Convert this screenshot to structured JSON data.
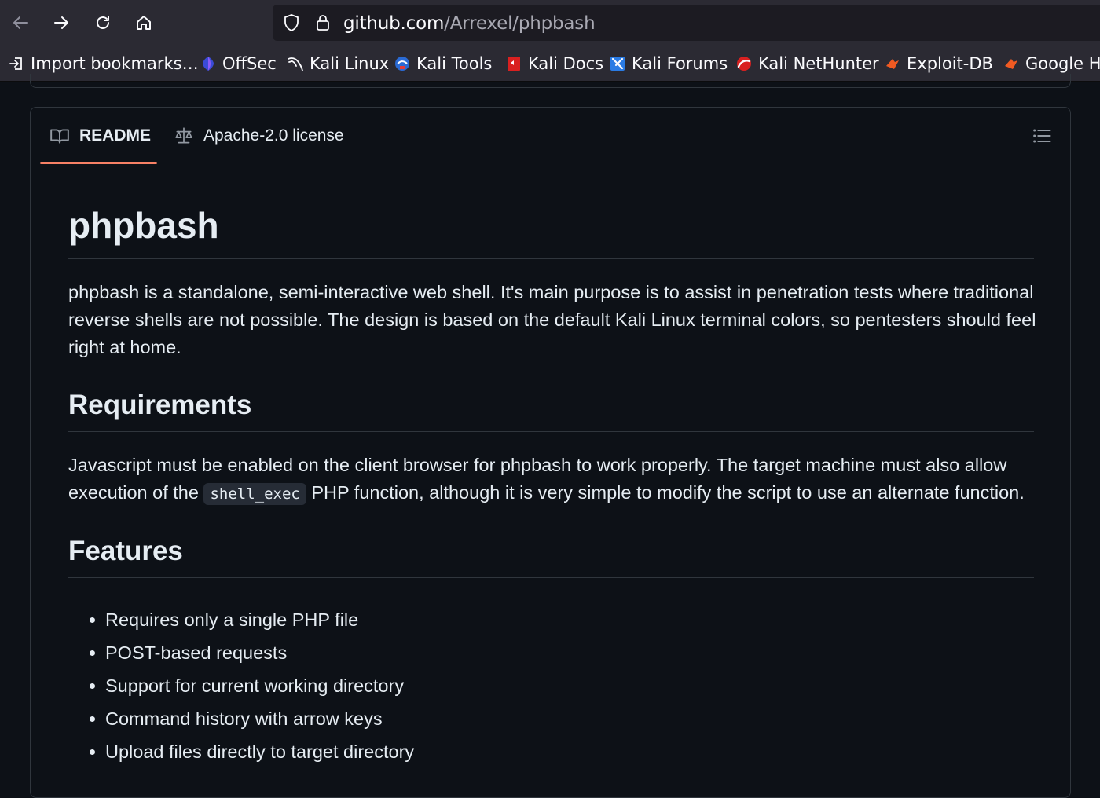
{
  "browser": {
    "url_host": "github.com",
    "url_path": "/Arrexel/phpbash",
    "bookmarks": [
      {
        "label": "Import bookmarks…",
        "icon": "import-icon"
      },
      {
        "label": "OffSec",
        "icon": "offsec-icon"
      },
      {
        "label": "Kali Linux",
        "icon": "kali-dragon-icon"
      },
      {
        "label": "Kali Tools",
        "icon": "kali-tools-icon"
      },
      {
        "label": "Kali Docs",
        "icon": "kali-docs-icon"
      },
      {
        "label": "Kali Forums",
        "icon": "kali-forums-icon"
      },
      {
        "label": "Kali NetHunter",
        "icon": "nethunter-icon"
      },
      {
        "label": "Exploit-DB",
        "icon": "exploitdb-icon"
      },
      {
        "label": "Google Ha",
        "icon": "ghdb-icon"
      }
    ]
  },
  "readme": {
    "tabs": {
      "readme": "README",
      "license": "Apache-2.0 license"
    },
    "title": "phpbash",
    "intro": "phpbash is a standalone, semi-interactive web shell. It's main purpose is to assist in penetration tests where traditional reverse shells are not possible. The design is based on the default Kali Linux terminal colors, so pentesters should feel right at home.",
    "requirements": {
      "heading": "Requirements",
      "text_before": "Javascript must be enabled on the client browser for phpbash to work properly. The target machine must also allow execution of the ",
      "code": "shell_exec",
      "text_after": " PHP function, although it is very simple to modify the script to use an alternate function."
    },
    "features": {
      "heading": "Features",
      "items": [
        "Requires only a single PHP file",
        "POST-based requests",
        "Support for current working directory",
        "Command history with arrow keys",
        "Upload files directly to target directory"
      ]
    }
  },
  "colors": {
    "background": "#0d1117",
    "border": "#30363d",
    "text": "#e6edf3",
    "tab_underline": "#f78166",
    "browser_chrome": "#2b2a33"
  }
}
